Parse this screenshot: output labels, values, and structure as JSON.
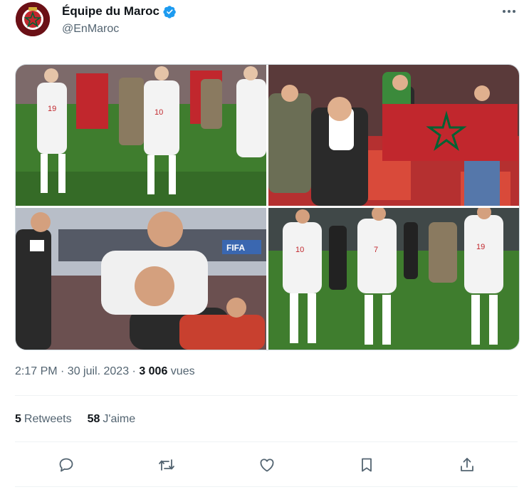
{
  "author": {
    "name": "Équipe du Maroc",
    "handle": "@EnMaroc",
    "verified_color": "#1d9bf0"
  },
  "media": {
    "photos": [
      {
        "icon": "players-celebrating-photo",
        "jersey_numbers": [
          "19",
          "10"
        ]
      },
      {
        "icon": "fans-with-flag-photo"
      },
      {
        "icon": "player-piggyback-photo",
        "sign": "FIFA"
      },
      {
        "icon": "players-dancing-photo",
        "jersey_numbers": [
          "10",
          "7",
          "19"
        ]
      }
    ]
  },
  "meta": {
    "time": "2:17 PM · 30 juil. 2023 · ",
    "views": "3 006",
    "views_label": " vues"
  },
  "stats": {
    "retweets_count": "5",
    "retweets_label": "Retweets",
    "likes_count": "58",
    "likes_label": "J'aime"
  },
  "colors": {
    "text": "#0f1419",
    "secondary": "#536471",
    "divider": "#eff3f4",
    "flag_red": "#c1272d",
    "flag_green": "#006233",
    "pitch": "#3f7d2e"
  }
}
